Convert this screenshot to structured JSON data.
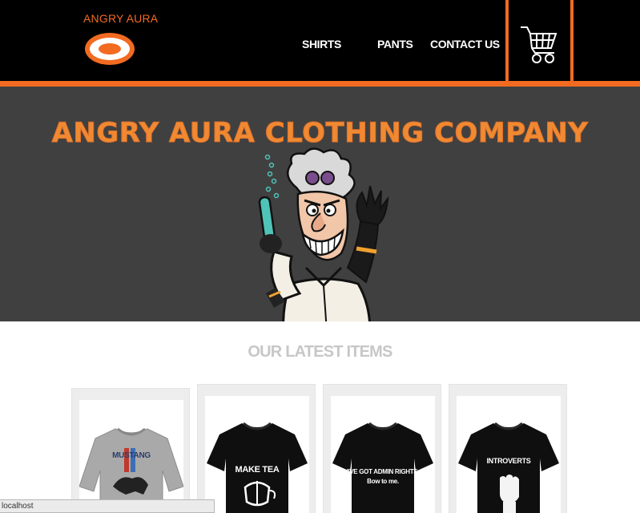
{
  "header": {
    "brand_name": "ANGRY AURA",
    "nav": {
      "shirts": "SHIRTS",
      "pants": "PANTS",
      "contact": "CONTACT US"
    },
    "cart_icon": "shopping-cart-icon"
  },
  "hero": {
    "title": "ANGRY AURA CLOTHING COMPANY",
    "mascot": "mad-scientist-illustration"
  },
  "latest": {
    "title": "OUR LATEST ITEMS",
    "items": [
      {
        "print": "MUSTANG",
        "color": "gray"
      },
      {
        "print": "MAKE TEA",
        "color": "black"
      },
      {
        "print_line1": "I'VE GOT ADMIN RIGHTS.",
        "print_line2": "Bow to me.",
        "color": "black"
      },
      {
        "print": "INTROVERTS",
        "color": "black"
      }
    ]
  },
  "statusbar": {
    "url": "localhost"
  },
  "colors": {
    "accent": "#f26b21",
    "header_bg": "#000000",
    "hero_bg": "#404040"
  }
}
